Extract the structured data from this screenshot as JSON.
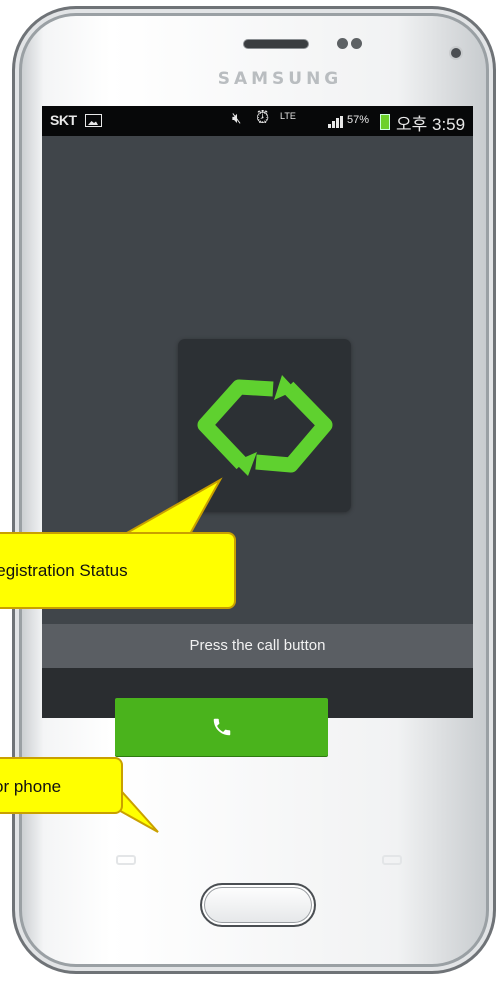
{
  "device": {
    "brand": "SAMSUNG"
  },
  "status_bar": {
    "carrier": "SKT",
    "network_badge": "LTE",
    "battery_percent": "57%",
    "time": "오후 3:59",
    "icons": [
      "image-icon",
      "mute-icon",
      "alarm-icon",
      "lte-icon",
      "signal-icon",
      "battery-charging-icon"
    ]
  },
  "app": {
    "status_logo_icon": "registration-status-icon",
    "accent_color": "#5fd12f",
    "hint_text": "Press the call button",
    "call_button_icon": "phone-icon",
    "call_button_color": "#4ab31c"
  },
  "annotations": {
    "registration": "Registration Status",
    "phone": "or phone"
  }
}
